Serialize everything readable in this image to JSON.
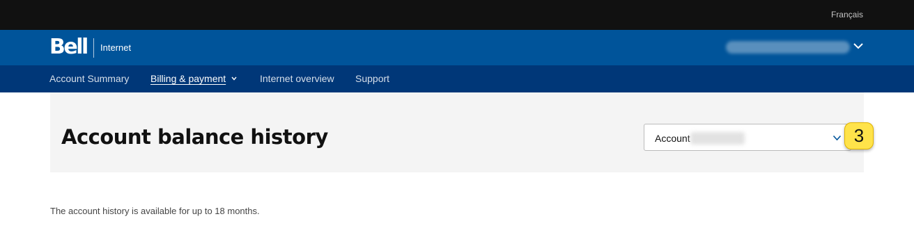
{
  "topbar": {
    "language_link": "Français"
  },
  "brand": {
    "logo_text": "Bell",
    "product_label": "Internet",
    "user_name": ""
  },
  "nav": {
    "items": [
      {
        "label": "Account Summary",
        "active": false
      },
      {
        "label": "Billing & payment",
        "active": true,
        "has_dropdown": true
      },
      {
        "label": "Internet overview",
        "active": false
      },
      {
        "label": "Support",
        "active": false
      }
    ]
  },
  "page": {
    "title": "Account balance history",
    "account_select": {
      "label": "Account",
      "value": ""
    },
    "info": "The account history is available for up to 18 months."
  },
  "annotation": {
    "step_number": "3"
  },
  "colors": {
    "topbar_bg": "#111111",
    "brand_bg": "#00549a",
    "nav_bg": "#003778",
    "panel_bg": "#f4f4f4",
    "badge_bg": "#ffe34a",
    "chevron": "#00549a"
  },
  "icons": {
    "user_menu": "chevron-down-icon",
    "nav_dropdown": "chevron-down-icon",
    "select": "chevron-down-icon"
  }
}
